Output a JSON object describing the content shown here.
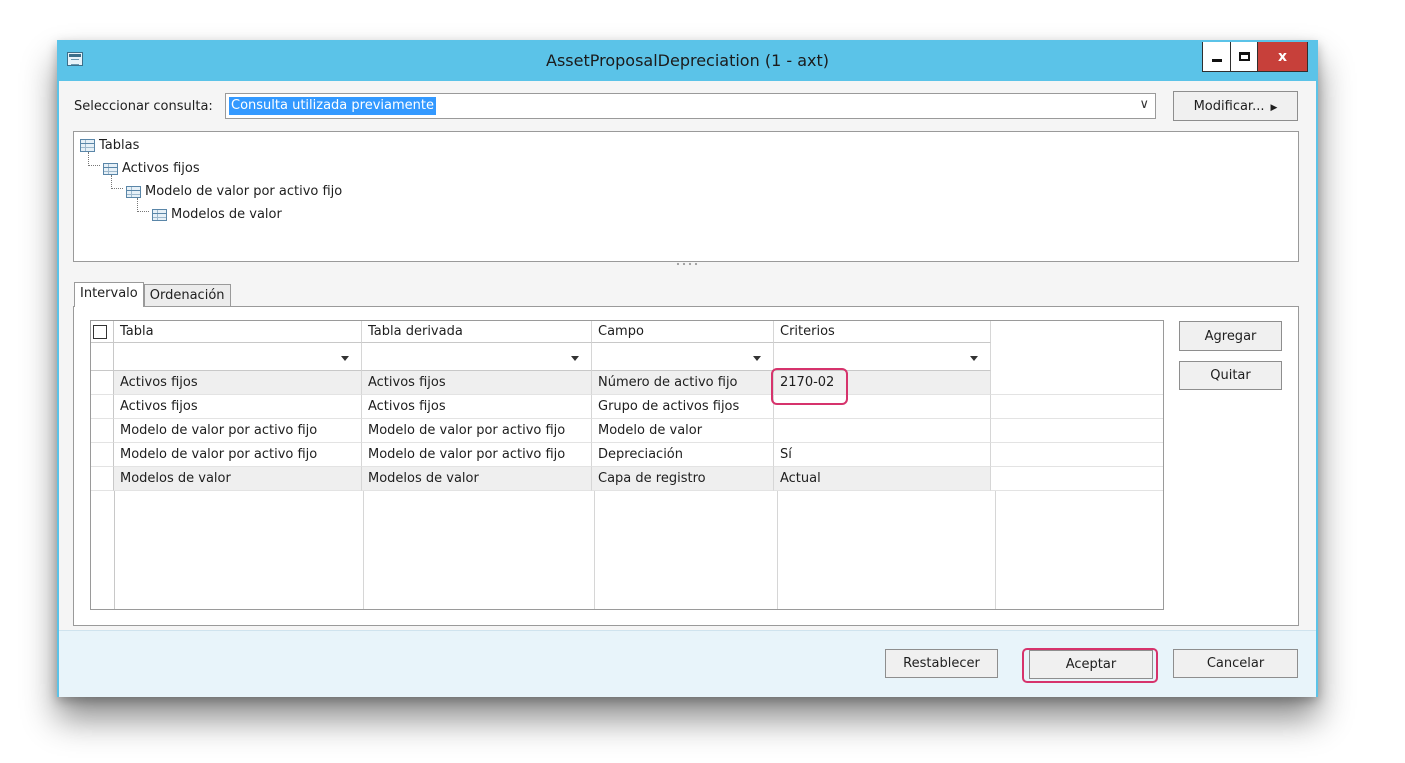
{
  "window": {
    "title": "AssetProposalDepreciation (1 - axt)",
    "controls": {
      "minimize": "–",
      "maximize": "□",
      "close": "x"
    }
  },
  "query": {
    "label": "Seleccionar consulta:",
    "selected": "Consulta utilizada previamente",
    "modify_label": "Modificar..."
  },
  "tree": {
    "root": "Tablas",
    "nodes": [
      {
        "label": "Activos fijos",
        "level": 1
      },
      {
        "label": "Modelo de valor por activo fijo",
        "level": 2
      },
      {
        "label": "Modelos de valor",
        "level": 3
      }
    ]
  },
  "tabs": [
    {
      "label": "Intervalo",
      "active": true
    },
    {
      "label": "Ordenación",
      "active": false
    }
  ],
  "grid": {
    "columns": [
      "Tabla",
      "Tabla derivada",
      "Campo",
      "Criterios"
    ],
    "rows": [
      [
        "Activos fijos",
        "Activos fijos",
        "Número de activo fijo",
        "2170-02"
      ],
      [
        "Activos fijos",
        "Activos fijos",
        "Grupo de activos fijos",
        ""
      ],
      [
        "Modelo de valor por activo fijo",
        "Modelo de valor por activo fijo",
        "Modelo de valor",
        ""
      ],
      [
        "Modelo de valor por activo fijo",
        "Modelo de valor por activo fijo",
        "Depreciación",
        "Sí"
      ],
      [
        "Modelos de valor",
        "Modelos de valor",
        "Capa de registro",
        "Actual"
      ]
    ],
    "shaded_rows": [
      0,
      4
    ]
  },
  "side_buttons": {
    "add": "Agregar",
    "remove": "Quitar"
  },
  "footer": {
    "reset": "Restablecer",
    "accept": "Aceptar",
    "cancel": "Cancelar"
  },
  "colors": {
    "titlebar": "#5bc3e8",
    "highlight": "#d6336c",
    "selection": "#3399ff",
    "close": "#c7403a"
  }
}
